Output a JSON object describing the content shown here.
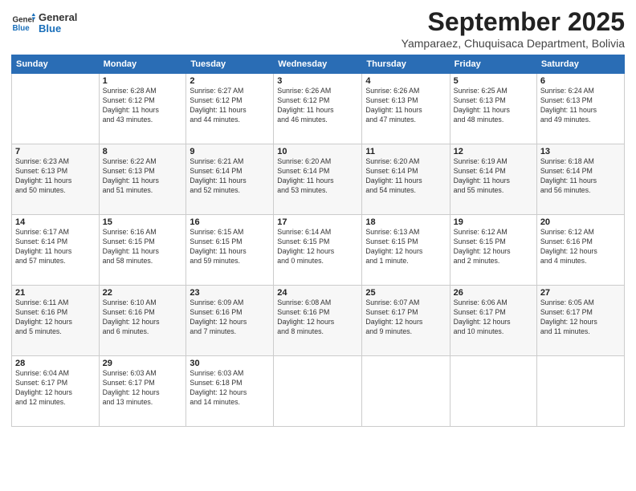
{
  "logo": {
    "line1": "General",
    "line2": "Blue"
  },
  "title": "September 2025",
  "subtitle": "Yamparaez, Chuquisaca Department, Bolivia",
  "weekdays": [
    "Sunday",
    "Monday",
    "Tuesday",
    "Wednesday",
    "Thursday",
    "Friday",
    "Saturday"
  ],
  "weeks": [
    [
      {
        "day": "",
        "info": ""
      },
      {
        "day": "1",
        "info": "Sunrise: 6:28 AM\nSunset: 6:12 PM\nDaylight: 11 hours\nand 43 minutes."
      },
      {
        "day": "2",
        "info": "Sunrise: 6:27 AM\nSunset: 6:12 PM\nDaylight: 11 hours\nand 44 minutes."
      },
      {
        "day": "3",
        "info": "Sunrise: 6:26 AM\nSunset: 6:12 PM\nDaylight: 11 hours\nand 46 minutes."
      },
      {
        "day": "4",
        "info": "Sunrise: 6:26 AM\nSunset: 6:13 PM\nDaylight: 11 hours\nand 47 minutes."
      },
      {
        "day": "5",
        "info": "Sunrise: 6:25 AM\nSunset: 6:13 PM\nDaylight: 11 hours\nand 48 minutes."
      },
      {
        "day": "6",
        "info": "Sunrise: 6:24 AM\nSunset: 6:13 PM\nDaylight: 11 hours\nand 49 minutes."
      }
    ],
    [
      {
        "day": "7",
        "info": "Sunrise: 6:23 AM\nSunset: 6:13 PM\nDaylight: 11 hours\nand 50 minutes."
      },
      {
        "day": "8",
        "info": "Sunrise: 6:22 AM\nSunset: 6:13 PM\nDaylight: 11 hours\nand 51 minutes."
      },
      {
        "day": "9",
        "info": "Sunrise: 6:21 AM\nSunset: 6:14 PM\nDaylight: 11 hours\nand 52 minutes."
      },
      {
        "day": "10",
        "info": "Sunrise: 6:20 AM\nSunset: 6:14 PM\nDaylight: 11 hours\nand 53 minutes."
      },
      {
        "day": "11",
        "info": "Sunrise: 6:20 AM\nSunset: 6:14 PM\nDaylight: 11 hours\nand 54 minutes."
      },
      {
        "day": "12",
        "info": "Sunrise: 6:19 AM\nSunset: 6:14 PM\nDaylight: 11 hours\nand 55 minutes."
      },
      {
        "day": "13",
        "info": "Sunrise: 6:18 AM\nSunset: 6:14 PM\nDaylight: 11 hours\nand 56 minutes."
      }
    ],
    [
      {
        "day": "14",
        "info": "Sunrise: 6:17 AM\nSunset: 6:14 PM\nDaylight: 11 hours\nand 57 minutes."
      },
      {
        "day": "15",
        "info": "Sunrise: 6:16 AM\nSunset: 6:15 PM\nDaylight: 11 hours\nand 58 minutes."
      },
      {
        "day": "16",
        "info": "Sunrise: 6:15 AM\nSunset: 6:15 PM\nDaylight: 11 hours\nand 59 minutes."
      },
      {
        "day": "17",
        "info": "Sunrise: 6:14 AM\nSunset: 6:15 PM\nDaylight: 12 hours\nand 0 minutes."
      },
      {
        "day": "18",
        "info": "Sunrise: 6:13 AM\nSunset: 6:15 PM\nDaylight: 12 hours\nand 1 minute."
      },
      {
        "day": "19",
        "info": "Sunrise: 6:12 AM\nSunset: 6:15 PM\nDaylight: 12 hours\nand 2 minutes."
      },
      {
        "day": "20",
        "info": "Sunrise: 6:12 AM\nSunset: 6:16 PM\nDaylight: 12 hours\nand 4 minutes."
      }
    ],
    [
      {
        "day": "21",
        "info": "Sunrise: 6:11 AM\nSunset: 6:16 PM\nDaylight: 12 hours\nand 5 minutes."
      },
      {
        "day": "22",
        "info": "Sunrise: 6:10 AM\nSunset: 6:16 PM\nDaylight: 12 hours\nand 6 minutes."
      },
      {
        "day": "23",
        "info": "Sunrise: 6:09 AM\nSunset: 6:16 PM\nDaylight: 12 hours\nand 7 minutes."
      },
      {
        "day": "24",
        "info": "Sunrise: 6:08 AM\nSunset: 6:16 PM\nDaylight: 12 hours\nand 8 minutes."
      },
      {
        "day": "25",
        "info": "Sunrise: 6:07 AM\nSunset: 6:17 PM\nDaylight: 12 hours\nand 9 minutes."
      },
      {
        "day": "26",
        "info": "Sunrise: 6:06 AM\nSunset: 6:17 PM\nDaylight: 12 hours\nand 10 minutes."
      },
      {
        "day": "27",
        "info": "Sunrise: 6:05 AM\nSunset: 6:17 PM\nDaylight: 12 hours\nand 11 minutes."
      }
    ],
    [
      {
        "day": "28",
        "info": "Sunrise: 6:04 AM\nSunset: 6:17 PM\nDaylight: 12 hours\nand 12 minutes."
      },
      {
        "day": "29",
        "info": "Sunrise: 6:03 AM\nSunset: 6:17 PM\nDaylight: 12 hours\nand 13 minutes."
      },
      {
        "day": "30",
        "info": "Sunrise: 6:03 AM\nSunset: 6:18 PM\nDaylight: 12 hours\nand 14 minutes."
      },
      {
        "day": "",
        "info": ""
      },
      {
        "day": "",
        "info": ""
      },
      {
        "day": "",
        "info": ""
      },
      {
        "day": "",
        "info": ""
      }
    ]
  ]
}
